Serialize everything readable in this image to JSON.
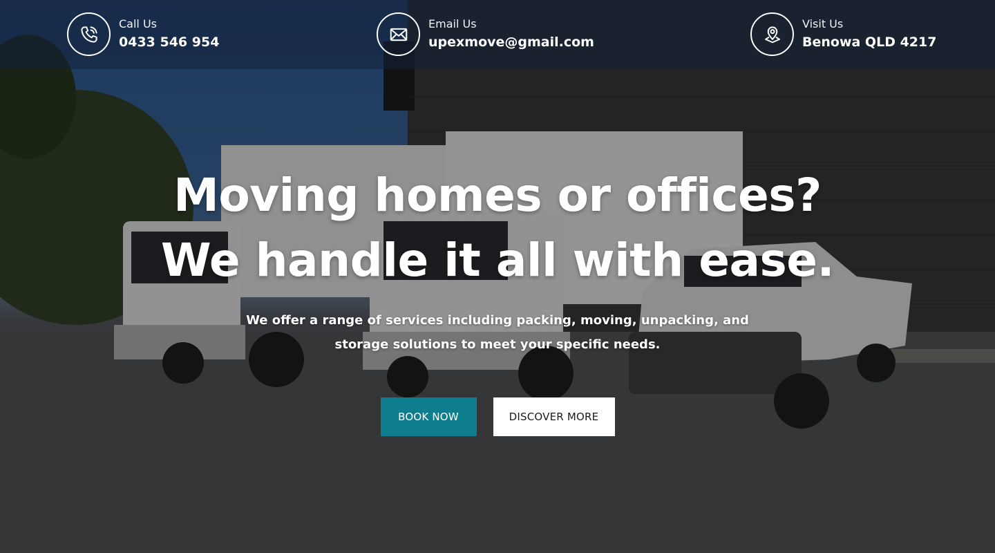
{
  "contacts": [
    {
      "label": "Call Us",
      "value": "0433 546 954",
      "icon": "phone-icon"
    },
    {
      "label": "Email Us",
      "value": "upexmove@gmail.com",
      "icon": "mail-icon"
    },
    {
      "label": "Visit Us",
      "value": "Benowa QLD 4217",
      "icon": "location-pin-icon"
    }
  ],
  "hero": {
    "title_line1": "Moving homes or offices?",
    "title_line2": "We handle it all with ease.",
    "subtitle": "We offer a range of services including packing, moving, unpacking, and storage solutions to meet your specific needs.",
    "primary_cta": "BOOK NOW",
    "secondary_cta": "DISCOVER MORE"
  },
  "colors": {
    "primary_button": "#0e7e8e",
    "secondary_button": "#ffffff",
    "topbar_overlay": "rgba(18,32,58,0.55)",
    "text": "#ffffff"
  }
}
